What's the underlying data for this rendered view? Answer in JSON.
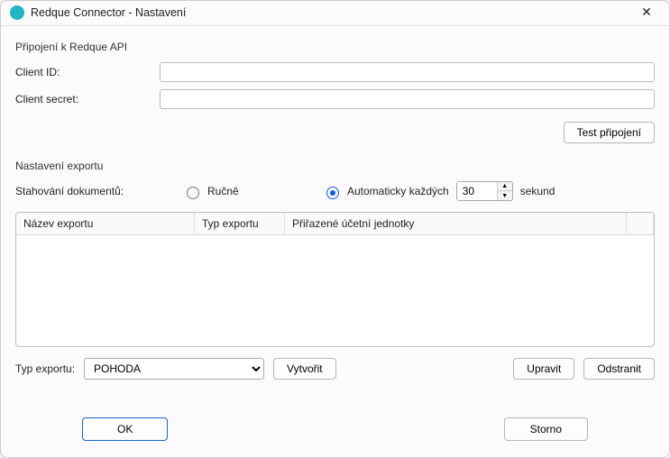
{
  "titlebar": {
    "title": "Redque Connector - Nastavení"
  },
  "api": {
    "section_title": "Připojení k Redque API",
    "client_id_label": "Client ID:",
    "client_id_value": "",
    "client_secret_label": "Client secret:",
    "client_secret_value": "",
    "test_button": "Test připojení"
  },
  "export": {
    "section_title": "Nastavení exportu",
    "download_label": "Stahování dokumentů:",
    "manual_label": "Ručně",
    "auto_label": "Automaticky každých",
    "auto_selected": true,
    "interval_value": "30",
    "interval_unit": "sekund",
    "grid": {
      "col_name": "Název exportu",
      "col_type": "Typ exportu",
      "col_units": "Přiřazené účetní jednotky",
      "rows": []
    },
    "type_label": "Typ exportu:",
    "type_selected": "POHODA",
    "type_options": [
      "POHODA"
    ],
    "create_button": "Vytvořit",
    "edit_button": "Upravit",
    "delete_button": "Odstranit"
  },
  "footer": {
    "ok": "OK",
    "cancel": "Storno"
  }
}
